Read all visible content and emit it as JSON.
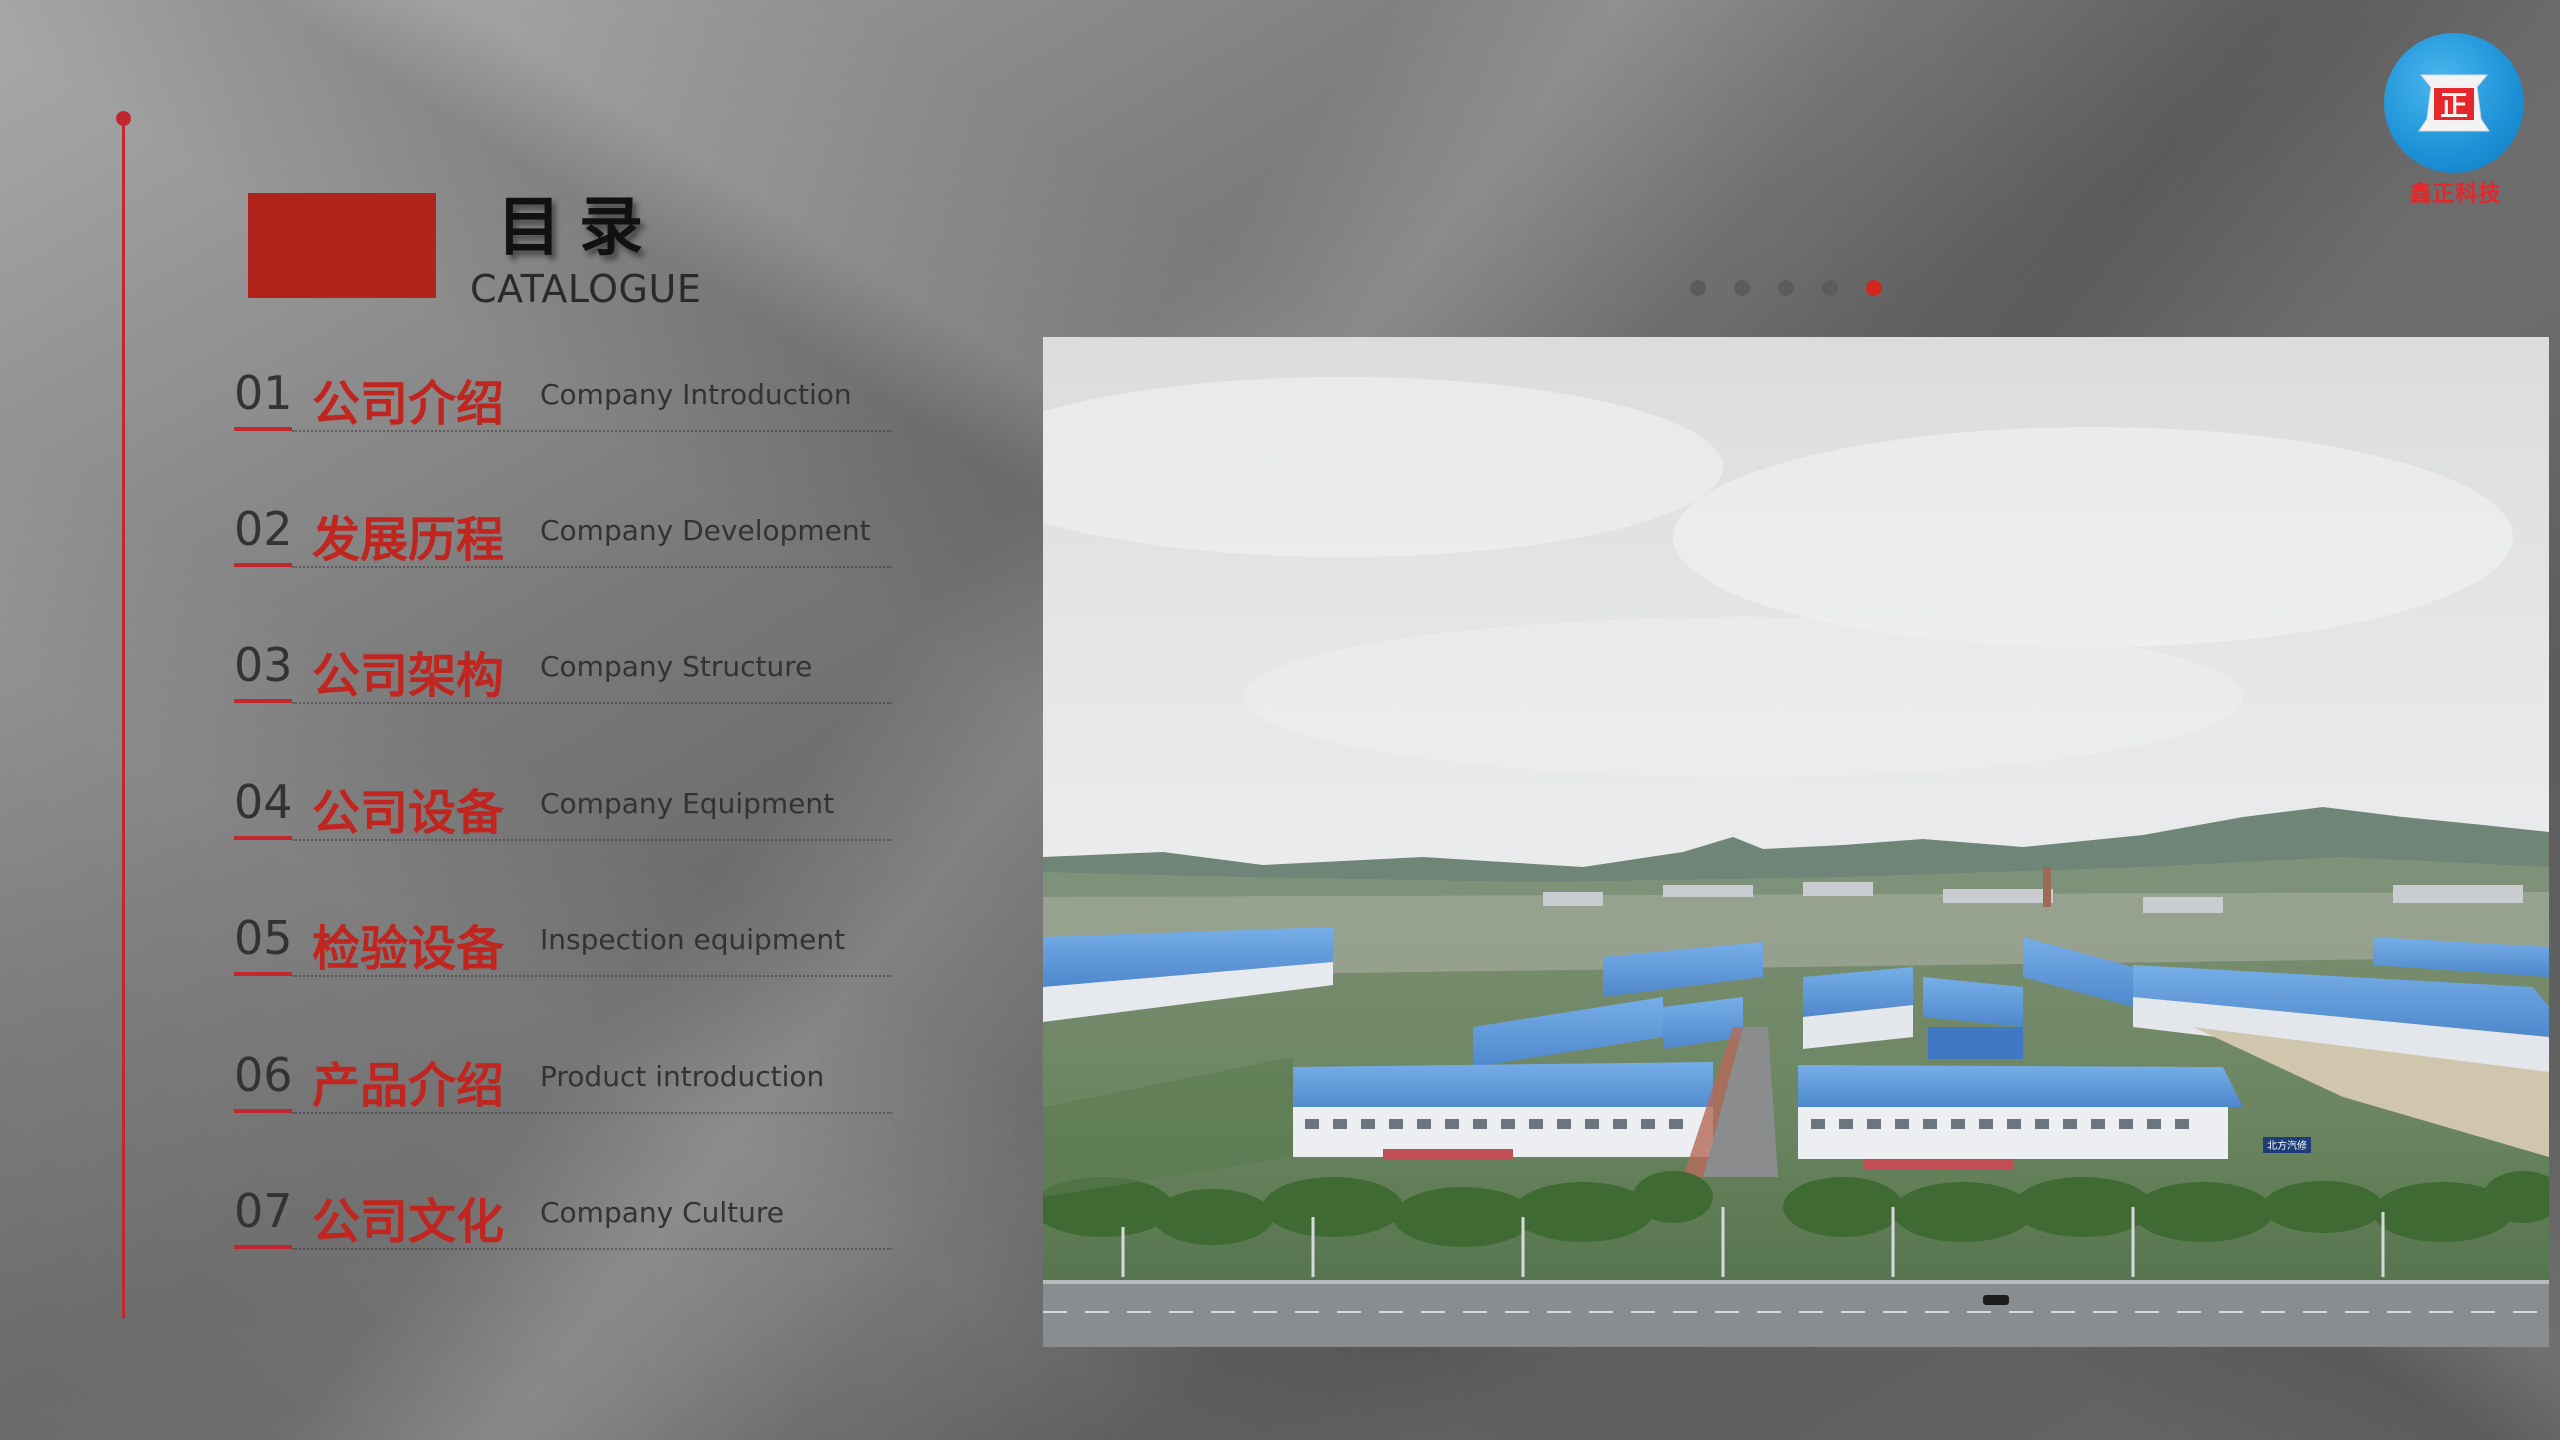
{
  "page": {
    "title_cn": "目录",
    "title_en": "CATALOGUE"
  },
  "logo": {
    "text": "鑫正科技",
    "mark_glyph": "正",
    "accent_color": "#1d91d6"
  },
  "pager": {
    "total": 5,
    "active_index": 4
  },
  "catalogue": [
    {
      "num": "01",
      "cn": "公司介绍",
      "en": "Company Introduction"
    },
    {
      "num": "02",
      "cn": "发展历程",
      "en": "Company Development"
    },
    {
      "num": "03",
      "cn": "公司架构",
      "en": "Company Structure"
    },
    {
      "num": "04",
      "cn": "公司设备",
      "en": "Company Equipment"
    },
    {
      "num": "05",
      "cn": "检验设备",
      "en": "Inspection equipment"
    },
    {
      "num": "06",
      "cn": "产品介绍",
      "en": "Product introduction"
    },
    {
      "num": "07",
      "cn": "公司文化",
      "en": "Company Culture"
    }
  ],
  "photo": {
    "sign_text": "北方汽修"
  },
  "colors": {
    "accent_red": "#c1272d",
    "block_red": "#b0241c",
    "factory_roof_blue": "#5a95d8"
  }
}
